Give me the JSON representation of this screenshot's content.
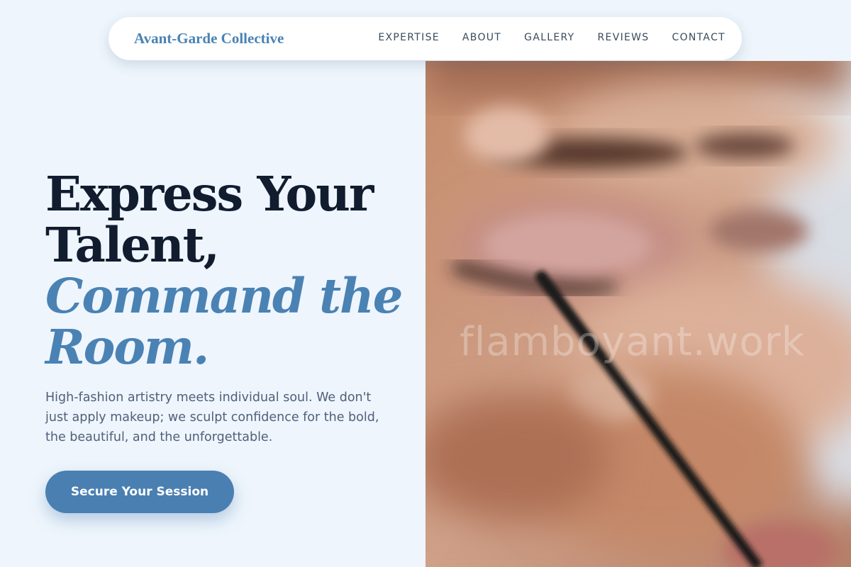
{
  "nav": {
    "brand": "Avant-Garde Collective",
    "links": [
      "EXPERTISE",
      "ABOUT",
      "GALLERY",
      "REVIEWS",
      "CONTACT"
    ]
  },
  "hero": {
    "headline_line1": "Express Your",
    "headline_line2": "Talent,",
    "headline_accent_line1": "Command the",
    "headline_accent_line2": "Room.",
    "subcopy": "High-fashion artistry meets individual soul. We don't just apply makeup; we sculpt confidence for the bold, the beautiful, and the unforgettable.",
    "cta_label": "Secure Your Session"
  },
  "image": {
    "watermark": "flamboyant.work"
  },
  "colors": {
    "accent": "#4a82b4",
    "headline": "#111c2f",
    "background": "#eef5fc",
    "button": "#4a7fb2"
  }
}
